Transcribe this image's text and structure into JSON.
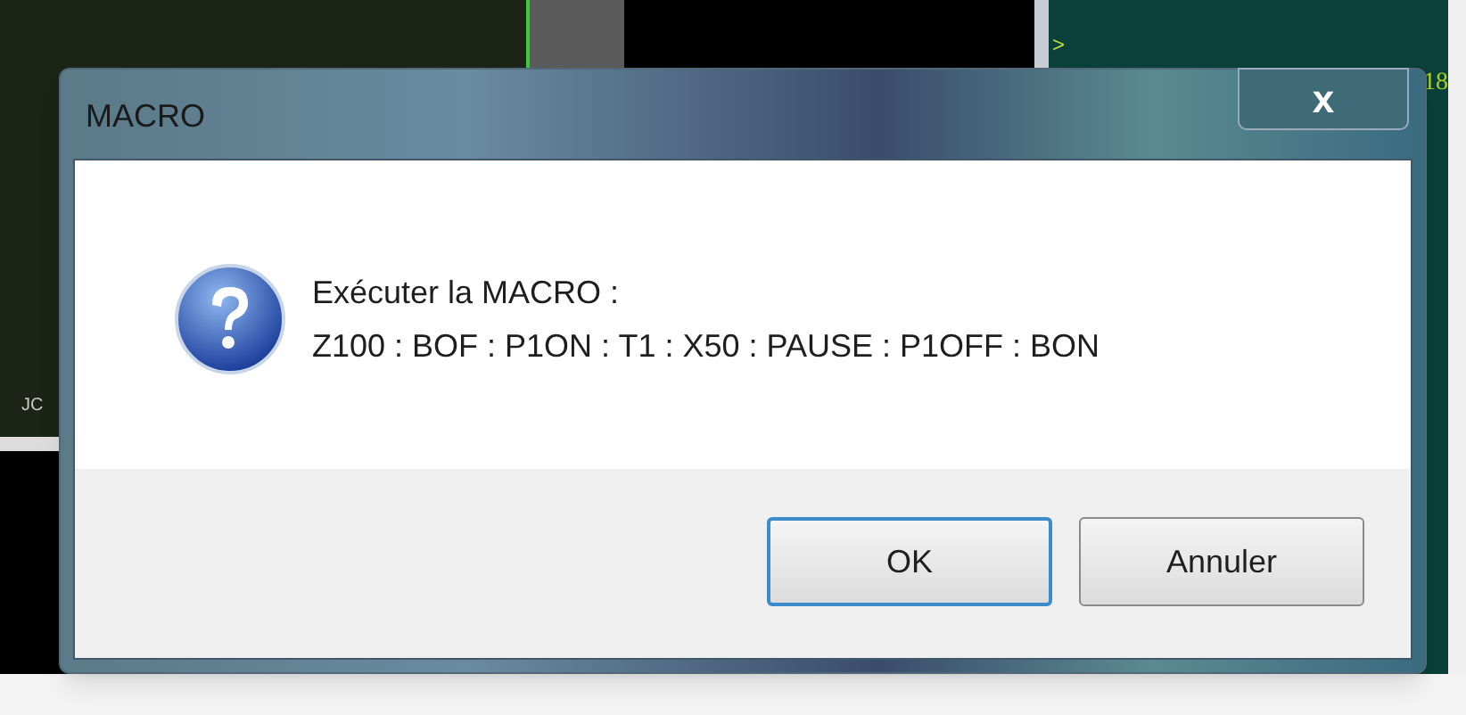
{
  "background": {
    "prompt": ">",
    "cut_number": "18",
    "side_label": "JC"
  },
  "dialog": {
    "title": "MACRO",
    "close": "x",
    "message_lines": [
      "Exécuter la MACRO :",
      "Z100 : BOF : P1ON : T1 : X50 : PAUSE : P1OFF : BON"
    ],
    "buttons": [
      {
        "label": "OK",
        "default": true
      },
      {
        "label": "Annuler",
        "default": false
      }
    ]
  }
}
